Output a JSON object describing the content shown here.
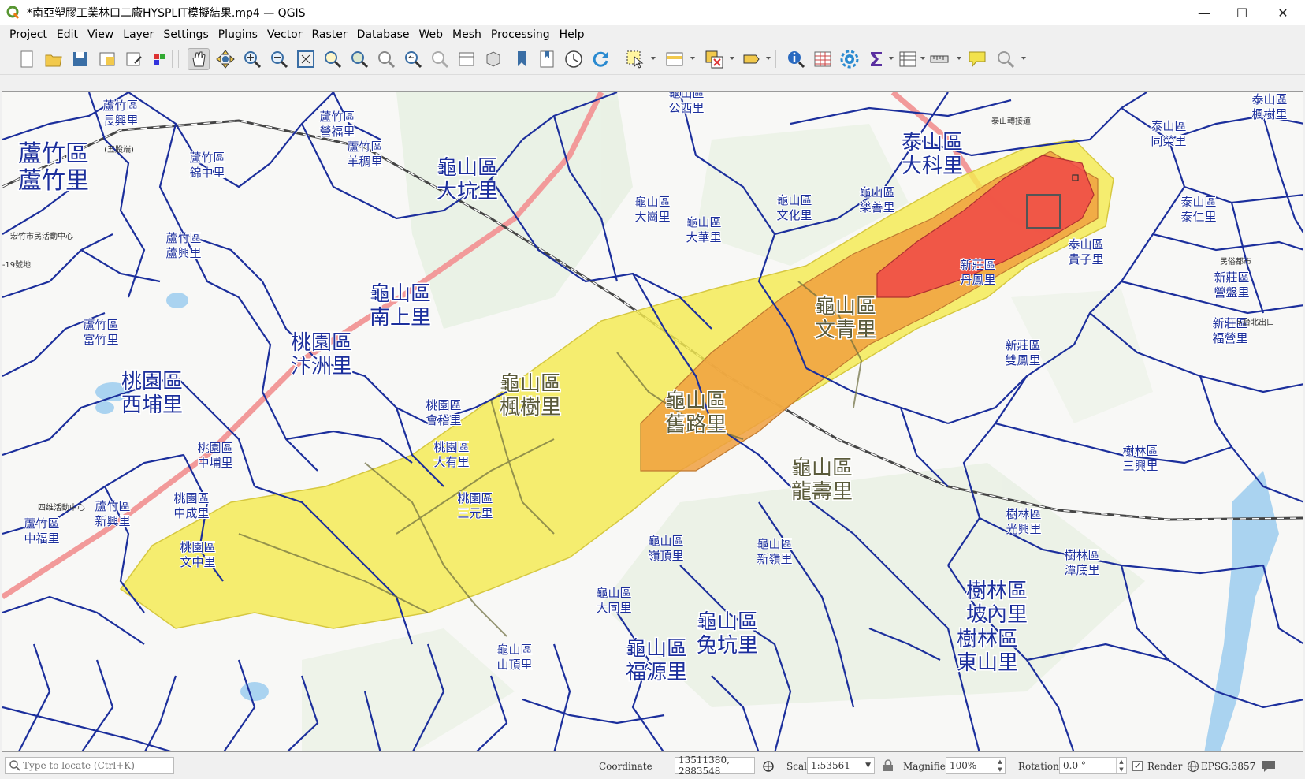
{
  "window": {
    "title": "*南亞塑膠工業林口二廠HYSPLIT模擬結果.mp4 — QGIS",
    "minimize_glyph": "—",
    "maximize_glyph": "☐",
    "close_glyph": "✕"
  },
  "menu": [
    "Project",
    "Edit",
    "View",
    "Layer",
    "Settings",
    "Plugins",
    "Vector",
    "Raster",
    "Database",
    "Web",
    "Mesh",
    "Processing",
    "Help"
  ],
  "toolbar": {
    "icons": [
      "new-project-icon",
      "open-project-icon",
      "save-project-icon",
      "new-print-layout-icon",
      "layout-manager-icon",
      "style-manager-icon",
      "pan-map-icon",
      "pan-to-selection-icon",
      "zoom-in-icon",
      "zoom-out-icon",
      "zoom-full-icon",
      "zoom-to-selection-icon",
      "zoom-to-layer-icon",
      "zoom-native-icon",
      "zoom-last-icon",
      "zoom-next-icon",
      "new-map-view-icon",
      "new-3d-map-view-icon",
      "new-spatial-bookmark-icon",
      "show-bookmarks-icon",
      "temporal-controller-icon",
      "refresh-icon",
      "select-features-icon",
      "attribute-table-select-icon",
      "deselect-icon",
      "select-by-value-icon",
      "identify-features-icon",
      "open-attribute-table-icon",
      "processing-toolbox-icon",
      "statistical-summary-icon",
      "field-calculator-icon",
      "measure-line-icon",
      "map-tips-icon",
      "locator-search-icon"
    ]
  },
  "map": {
    "plume_colors": {
      "yellow": "#f4ea50",
      "orange": "#f0a040",
      "red": "#f04848",
      "boundary": "#1c2f9c",
      "highway": "#f08a8a"
    },
    "large_labels": [
      {
        "l1": "蘆竹區",
        "l2": "蘆竹里"
      },
      {
        "l1": "龜山區",
        "l2": "大坑里"
      },
      {
        "l1": "泰山區",
        "l2": "大科里"
      },
      {
        "l1": "龜山區",
        "l2": "南上里"
      },
      {
        "l1": "桃園區",
        "l2": "汴洲里"
      },
      {
        "l1": "桃園區",
        "l2": "西埔里"
      },
      {
        "l1": "龜山區",
        "l2": "楓樹里"
      },
      {
        "l1": "龜山區",
        "l2": "舊路里"
      },
      {
        "l1": "龜山區",
        "l2": "龍壽里"
      },
      {
        "l1": "龜山區",
        "l2": "文青里"
      },
      {
        "l1": "龜山區",
        "l2": "兔坑里"
      },
      {
        "l1": "龜山區",
        "l2": "福源里"
      },
      {
        "l1": "樹林區",
        "l2": "東山里"
      },
      {
        "l1": "樹林區",
        "l2": "坡內里"
      }
    ],
    "small_labels": [
      {
        "l1": "蘆竹區",
        "l2": "長興里"
      },
      {
        "l1": "蘆竹區",
        "l2": "營福里"
      },
      {
        "l1": "蘆竹區",
        "l2": "羊稠里"
      },
      {
        "l1": "蘆竹區",
        "l2": "錦中里"
      },
      {
        "l1": "龜山區",
        "l2": "公西里"
      },
      {
        "l1": "龜山區",
        "l2": "大崗里"
      },
      {
        "l1": "龜山區",
        "l2": "大華里"
      },
      {
        "l1": "龜山區",
        "l2": "文化里"
      },
      {
        "l1": "龜山區",
        "l2": "樂善里"
      },
      {
        "l1": "泰山區",
        "l2": "楓樹里"
      },
      {
        "l1": "泰山區",
        "l2": "同榮里"
      },
      {
        "l1": "泰山區",
        "l2": "泰仁里"
      },
      {
        "l1": "泰山區",
        "l2": "貴子里"
      },
      {
        "l1": "新莊區",
        "l2": "丹鳳里"
      },
      {
        "l1": "新莊區",
        "l2": "營盤里"
      },
      {
        "l1": "新莊區",
        "l2": "福營里"
      },
      {
        "l1": "新莊區",
        "l2": "雙鳳里"
      },
      {
        "l1": "蘆竹區",
        "l2": "蘆興里"
      },
      {
        "l1": "蘆竹區",
        "l2": "富竹里"
      },
      {
        "l1": "蘆竹區",
        "l2": "新興里"
      },
      {
        "l1": "蘆竹區",
        "l2": "中福里"
      },
      {
        "l1": "桃園區",
        "l2": "中埔里"
      },
      {
        "l1": "桃園區",
        "l2": "中成里"
      },
      {
        "l1": "桃園區",
        "l2": "文中里"
      },
      {
        "l1": "桃園區",
        "l2": "會稽里"
      },
      {
        "l1": "桃園區",
        "l2": "大有里"
      },
      {
        "l1": "桃園區",
        "l2": "三元里"
      },
      {
        "l1": "龜山區",
        "l2": "嶺頂里"
      },
      {
        "l1": "龜山區",
        "l2": "新嶺里"
      },
      {
        "l1": "龜山區",
        "l2": "大同里"
      },
      {
        "l1": "龜山區",
        "l2": "山頂里"
      },
      {
        "l1": "樹林區",
        "l2": "三興里"
      },
      {
        "l1": "樹林區",
        "l2": "光興里"
      },
      {
        "l1": "樹林區",
        "l2": "潭底里"
      }
    ],
    "tiny_labels": [
      "(五股端)",
      "民俗都市",
      ">台北出口",
      "泰山轉接道",
      "-19號地",
      "四维活動中心",
      "宏竹市民活動中心"
    ]
  },
  "status": {
    "locate_placeholder": "Type to locate (Ctrl+K)",
    "coordinate_label": "Coordinate",
    "coordinate_value": "13511380, 2883548",
    "scale_label": "Scale",
    "scale_value": "1:53561",
    "magnifier_label": "Magnifier",
    "magnifier_value": "100%",
    "rotation_label": "Rotation",
    "rotation_value": "0.0 °",
    "render_label": "Render",
    "render_checked": "✓",
    "crs_label": "EPSG:3857"
  }
}
